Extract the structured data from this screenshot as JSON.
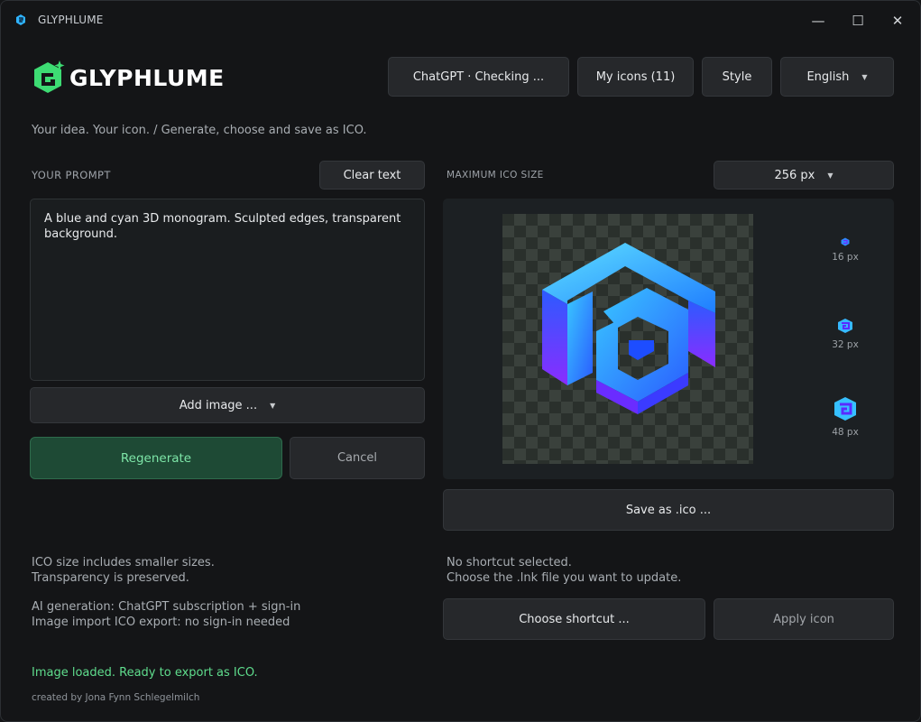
{
  "window": {
    "title": "GLYPHLUME",
    "controls": {
      "minimize": "—",
      "maximize": "☐",
      "close": "✕"
    }
  },
  "logo": {
    "wordmark": "GLYPHLUME",
    "icon": "glyphlume-logo-icon",
    "accent": "#3ddc73"
  },
  "header": {
    "provider_label": "ChatGPT · Checking ...",
    "my_icons_label": "My icons (11)",
    "style_label": "Style",
    "language_label": "English"
  },
  "tagline": "Your idea. Your icon.  /  Generate, choose and save as ICO.",
  "prompt": {
    "section_label": "YOUR PROMPT",
    "clear_label": "Clear text",
    "text": "A blue and cyan 3D monogram. Sculpted edges, transparent background.",
    "add_image_label": "Add image ...",
    "regenerate_label": "Regenerate",
    "cancel_label": "Cancel"
  },
  "output": {
    "max_size_label": "MAXIMUM ICO SIZE",
    "max_size_value": "256 px",
    "previews": [
      {
        "caption": "16 px"
      },
      {
        "caption": "32 px"
      },
      {
        "caption": "48 px"
      }
    ],
    "save_label": "Save as .ico ..."
  },
  "notes": {
    "line1": "ICO size includes smaller sizes.",
    "line2": "Transparency is preserved.",
    "line3": "AI generation: ChatGPT subscription + sign-in",
    "line4": "Image import  ICO export: no sign-in needed"
  },
  "shortcut": {
    "status_line1": "No shortcut selected.",
    "status_line2": "Choose the .lnk file you want to update.",
    "choose_label": "Choose shortcut ...",
    "apply_label": "Apply icon"
  },
  "status": "Image loaded. Ready to export as ICO.",
  "credit": "created by Jona Fynn Schlegelmilch",
  "colors": {
    "accent_green": "#5fdd8d",
    "icon_cyan": "#36c8ff",
    "icon_violet": "#7a3cff"
  }
}
